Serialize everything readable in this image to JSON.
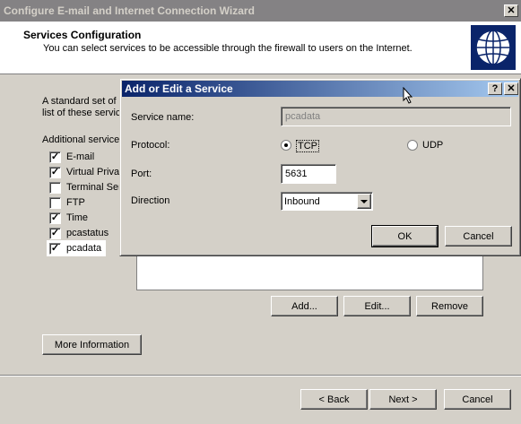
{
  "wizard": {
    "title": "Configure E-mail and Internet Connection Wizard",
    "close_glyph": "✕",
    "header": {
      "title": "Services Configuration",
      "subtitle": "You can select services to be accessible through the firewall to users on the Internet.",
      "icon": "globe-icon"
    },
    "intro_line1": "A standard set of s",
    "intro_line2": "list of these servic",
    "additional_label": "Additional services",
    "services": [
      {
        "label": "E-mail",
        "checked": true
      },
      {
        "label": "Virtual Privat",
        "checked": true
      },
      {
        "label": "Terminal Ser",
        "checked": false
      },
      {
        "label": "FTP",
        "checked": false
      },
      {
        "label": "Time",
        "checked": true
      },
      {
        "label": "pcastatus",
        "checked": true
      },
      {
        "label": "pcadata",
        "checked": true
      }
    ],
    "add_button": "Add...",
    "edit_button": "Edit...",
    "remove_button": "Remove",
    "more_info_button": "More Information",
    "back_button": "< Back",
    "next_button": "Next >",
    "cancel_button": "Cancel"
  },
  "dialog": {
    "title": "Add or Edit a Service",
    "help_glyph": "?",
    "close_glyph": "✕",
    "service_name_label": "Service name:",
    "service_name_value": "pcadata",
    "protocol_label": "Protocol:",
    "tcp_label": "TCP",
    "udp_label": "UDP",
    "protocol_selected": "TCP",
    "port_label": "Port:",
    "port_value": "5631",
    "direction_label": "Direction",
    "direction_value": "Inbound",
    "ok_button": "OK",
    "cancel_button": "Cancel"
  },
  "colors": {
    "dialog_title_start": "#0a246a",
    "dialog_title_end": "#a6caf0",
    "inactive_title": "#848284"
  }
}
